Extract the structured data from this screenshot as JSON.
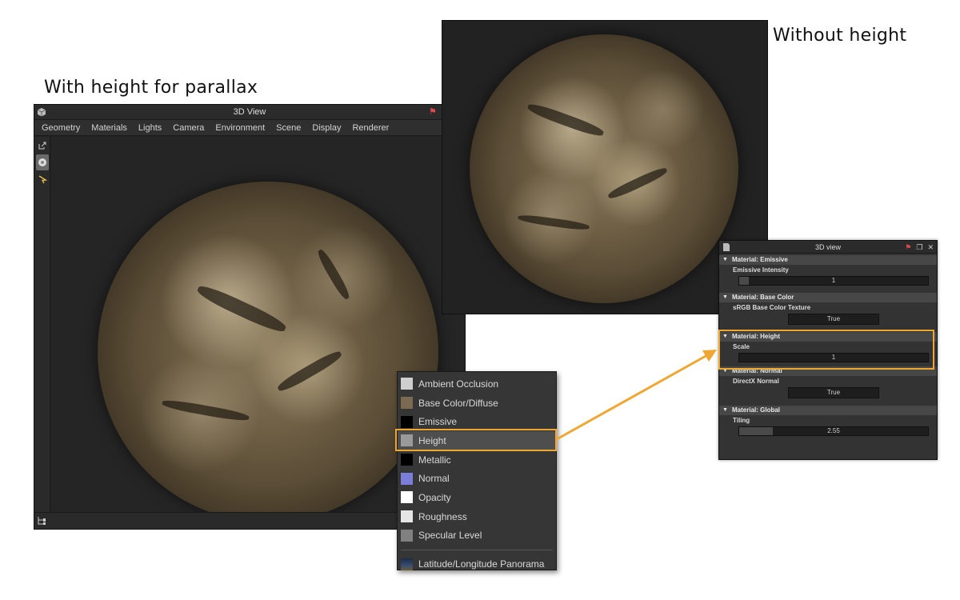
{
  "captions": {
    "left": "With height for parallax",
    "right": "Without height"
  },
  "main_window": {
    "title": "3D View",
    "menus": [
      "Geometry",
      "Materials",
      "Lights",
      "Camera",
      "Environment",
      "Scene",
      "Display",
      "Renderer"
    ]
  },
  "properties_panel": {
    "title": "3D view",
    "sections": {
      "emissive": {
        "header": "Material: Emissive",
        "label": "Emissive Intensity",
        "value": "1",
        "fill": 0.05
      },
      "base_color": {
        "header": "Material: Base Color",
        "label": "sRGB Base Color Texture",
        "value": "True"
      },
      "height": {
        "header": "Material: Height",
        "label": "Scale",
        "value": "1"
      },
      "normal": {
        "header": "Material: Normal",
        "label": "DirectX Normal",
        "value": "True"
      },
      "global": {
        "header": "Material: Global",
        "label": "Tiling",
        "value": "2.55",
        "fill": 0.18
      }
    }
  },
  "channels": {
    "items": [
      {
        "label": "Ambient Occlusion",
        "swatch": "#cfcfcf"
      },
      {
        "label": "Base Color/Diffuse",
        "swatch": "#7a6a52"
      },
      {
        "label": "Emissive",
        "swatch": "#000000"
      },
      {
        "label": "Height",
        "swatch": "#9a9a9a",
        "selected": true
      },
      {
        "label": "Metallic",
        "swatch": "#000000"
      },
      {
        "label": "Normal",
        "swatch": "#7b7ed8"
      },
      {
        "label": "Opacity",
        "swatch": "#ffffff"
      },
      {
        "label": "Roughness",
        "swatch": "#e6e6e6"
      },
      {
        "label": "Specular Level",
        "swatch": "#808080"
      }
    ],
    "panorama": {
      "label": "Latitude/Longitude Panorama",
      "swatch": "#2a3a55"
    }
  },
  "colors": {
    "highlight": "#f0a732",
    "panel_bg": "#333333"
  }
}
